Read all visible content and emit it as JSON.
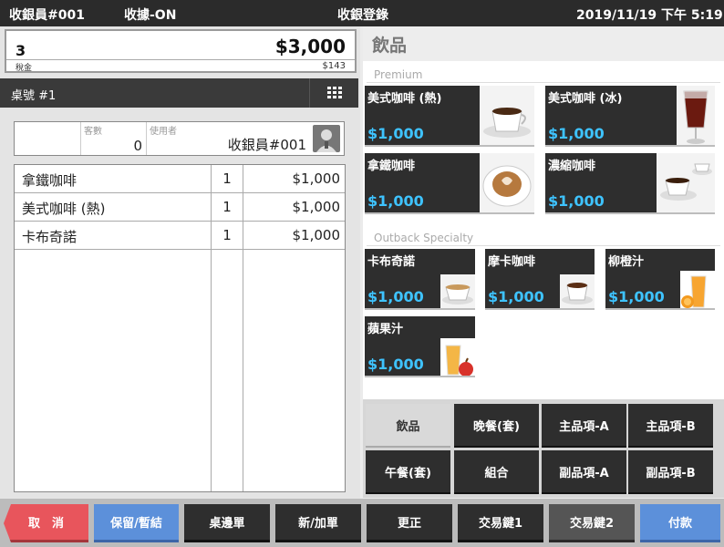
{
  "topbar": {
    "cashier": "收銀員#001",
    "receipt": "收據-ON",
    "title": "收銀登錄",
    "datetime": "2019/11/19 下午 5:19"
  },
  "totals": {
    "quantity": "3",
    "amount": "$3,000",
    "tax_label": "稅金",
    "tax_value": "$143"
  },
  "table": {
    "label": "桌號 #1",
    "grid_icon": "grid-icon"
  },
  "customer": {
    "count_hint": "客數",
    "count_value": "0",
    "user_hint": "使用者",
    "user_value": "收銀員#001",
    "avatar_icon": "person-icon"
  },
  "orders": [
    {
      "name": "拿鐵咖啡",
      "qty": "1",
      "price": "$1,000"
    },
    {
      "name": "美式咖啡 (熱)",
      "qty": "1",
      "price": "$1,000"
    },
    {
      "name": "卡布奇諾",
      "qty": "1",
      "price": "$1,000"
    }
  ],
  "category_title": "飲品",
  "sections": {
    "premium": "Premium",
    "outback": "Outback Specialty"
  },
  "premium_items": [
    {
      "name": "美式咖啡 (熱)",
      "price": "$1,000",
      "icon": "hot-coffee-icon"
    },
    {
      "name": "美式咖啡 (冰)",
      "price": "$1,000",
      "icon": "iced-coffee-icon"
    },
    {
      "name": "拿鐵咖啡",
      "price": "$1,000",
      "icon": "latte-icon"
    },
    {
      "name": "濃縮咖啡",
      "price": "$1,000",
      "icon": "espresso-icon"
    }
  ],
  "outback_items": [
    {
      "name": "卡布奇諾",
      "price": "$1,000",
      "icon": "cappuccino-icon"
    },
    {
      "name": "摩卡咖啡",
      "price": "$1,000",
      "icon": "mocha-icon"
    },
    {
      "name": "柳橙汁",
      "price": "$1,000",
      "icon": "orange-juice-icon"
    },
    {
      "name": "蘋果汁",
      "price": "$1,000",
      "icon": "apple-juice-icon"
    }
  ],
  "categories": [
    "飲品",
    "晚餐(套)",
    "主品項-A",
    "主品項-B",
    "午餐(套)",
    "組合",
    "副品項-A",
    "副品項-B"
  ],
  "bottom": {
    "cancel": "取　消",
    "hold": "保留/暫結",
    "table_order": "桌邊單",
    "new_add": "新/加單",
    "correct": "更正",
    "key1": "交易鍵1",
    "key2": "交易鍵2",
    "pay": "付款"
  },
  "colors": {
    "price_accent": "#3ec3ff",
    "cancel": "#e8555c",
    "blue_button": "#5c90da",
    "dark_tile": "#2e2e2e"
  }
}
